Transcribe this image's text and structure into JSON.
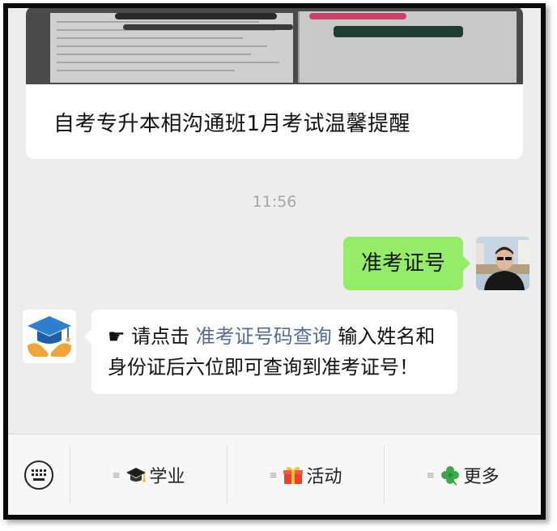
{
  "article": {
    "title": "自考专升本相沟通班1月考试温馨提醒"
  },
  "chat": {
    "time": "11:56",
    "outgoing_text": "准考证号",
    "incoming": {
      "prefix": "☛ 请点击 ",
      "link_text": "准考证号码查询",
      "suffix": " 输入姓名和身份证后六位即可查询到准考证号！"
    }
  },
  "menu": {
    "lines_glyph": "≡",
    "items": [
      {
        "label": "学业",
        "icon": "graduation-cap-icon"
      },
      {
        "label": "活动",
        "icon": "gift-icon"
      },
      {
        "label": "更多",
        "icon": "clover-icon"
      }
    ]
  },
  "colors": {
    "outgoing_bubble": "#95ec69",
    "link": "#576b95",
    "background": "#ededed"
  }
}
